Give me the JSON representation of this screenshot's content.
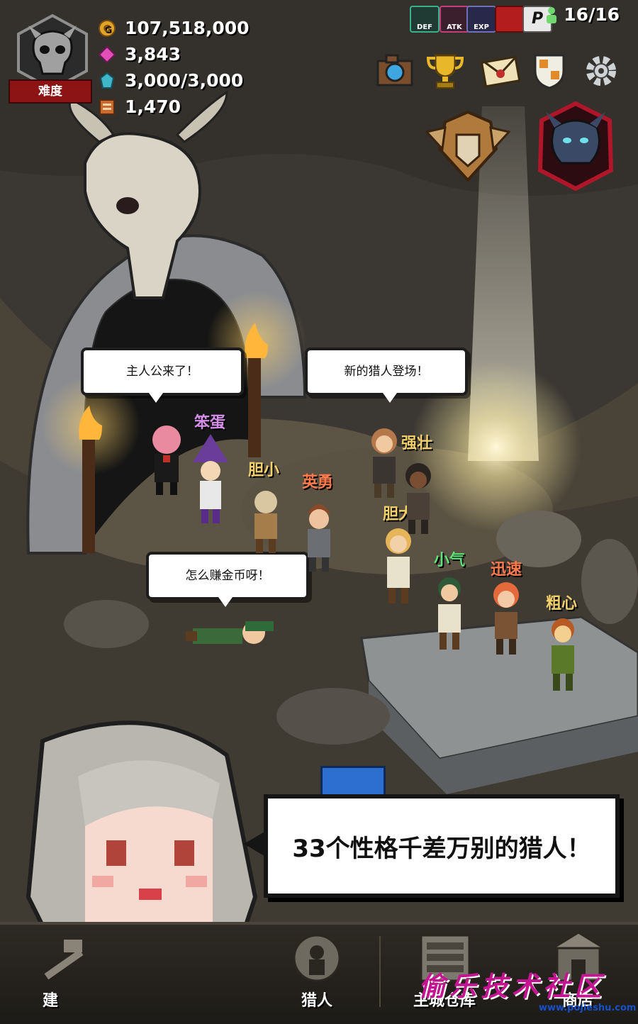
{
  "resources": [
    {
      "icon": "gold-coin-icon",
      "value": "107,518,000",
      "color": "#e0a526"
    },
    {
      "icon": "pink-gem-icon",
      "value": "3,843",
      "color": "#e24fb8"
    },
    {
      "icon": "blue-crystal-icon",
      "value": "3,000/3,000",
      "color": "#42b6c9"
    },
    {
      "icon": "ticket-icon",
      "value": "1,470",
      "color": "#c96b2e"
    }
  ],
  "difficulty": {
    "label": "难度",
    "icon": "demon-skull-icon"
  },
  "status_buffs": [
    {
      "icon": "def-buff-icon",
      "label": "DEF",
      "color": "#3ab08a"
    },
    {
      "icon": "atk-buff-icon",
      "label": "ATK",
      "color": "#c0407a"
    },
    {
      "icon": "exp-buff-icon",
      "label": "EXP",
      "color": "#6f6fb8"
    },
    {
      "icon": "gift-buff-icon",
      "label": "",
      "color": "#b31d1d"
    },
    {
      "icon": "pass-buff-icon",
      "label": "P",
      "color": "#e8e8e8"
    }
  ],
  "population": {
    "icon": "person-icon",
    "value": "16/16"
  },
  "top_menu": [
    {
      "icon": "camera-icon"
    },
    {
      "icon": "trophy-icon"
    },
    {
      "icon": "mail-icon"
    },
    {
      "icon": "guild-emblem-icon"
    },
    {
      "icon": "gear-icon"
    }
  ],
  "speech": {
    "left": "主人公来了！",
    "right": "新的猎人登场！",
    "bottom": "怎么赚金币呀！"
  },
  "hunter_tags": [
    {
      "text": "笨蛋",
      "color": "#d58ee8"
    },
    {
      "text": "胆小",
      "color": "#f2d06b"
    },
    {
      "text": "英勇",
      "color": "#ff7a4d"
    },
    {
      "text": "强壮",
      "color": "#f2d06b"
    },
    {
      "text": "胆大",
      "color": "#f2d06b"
    },
    {
      "text": "小气",
      "color": "#5fe07a"
    },
    {
      "text": "迅速",
      "color": "#ff7a4d"
    },
    {
      "text": "粗心",
      "color": "#f2d06b"
    }
  ],
  "promo_text": "33个性格千差万别的猎人！",
  "bottom_nav": [
    {
      "label": "建",
      "icon": "hammer-icon"
    },
    {
      "label": "猎人",
      "icon": "hunter-icon"
    },
    {
      "label": "主城仓库",
      "icon": "warehouse-icon"
    },
    {
      "label": "商店",
      "icon": "shop-icon"
    }
  ],
  "watermark": {
    "text": "偷乐技术社区",
    "url": "www.pojieshu.com"
  }
}
